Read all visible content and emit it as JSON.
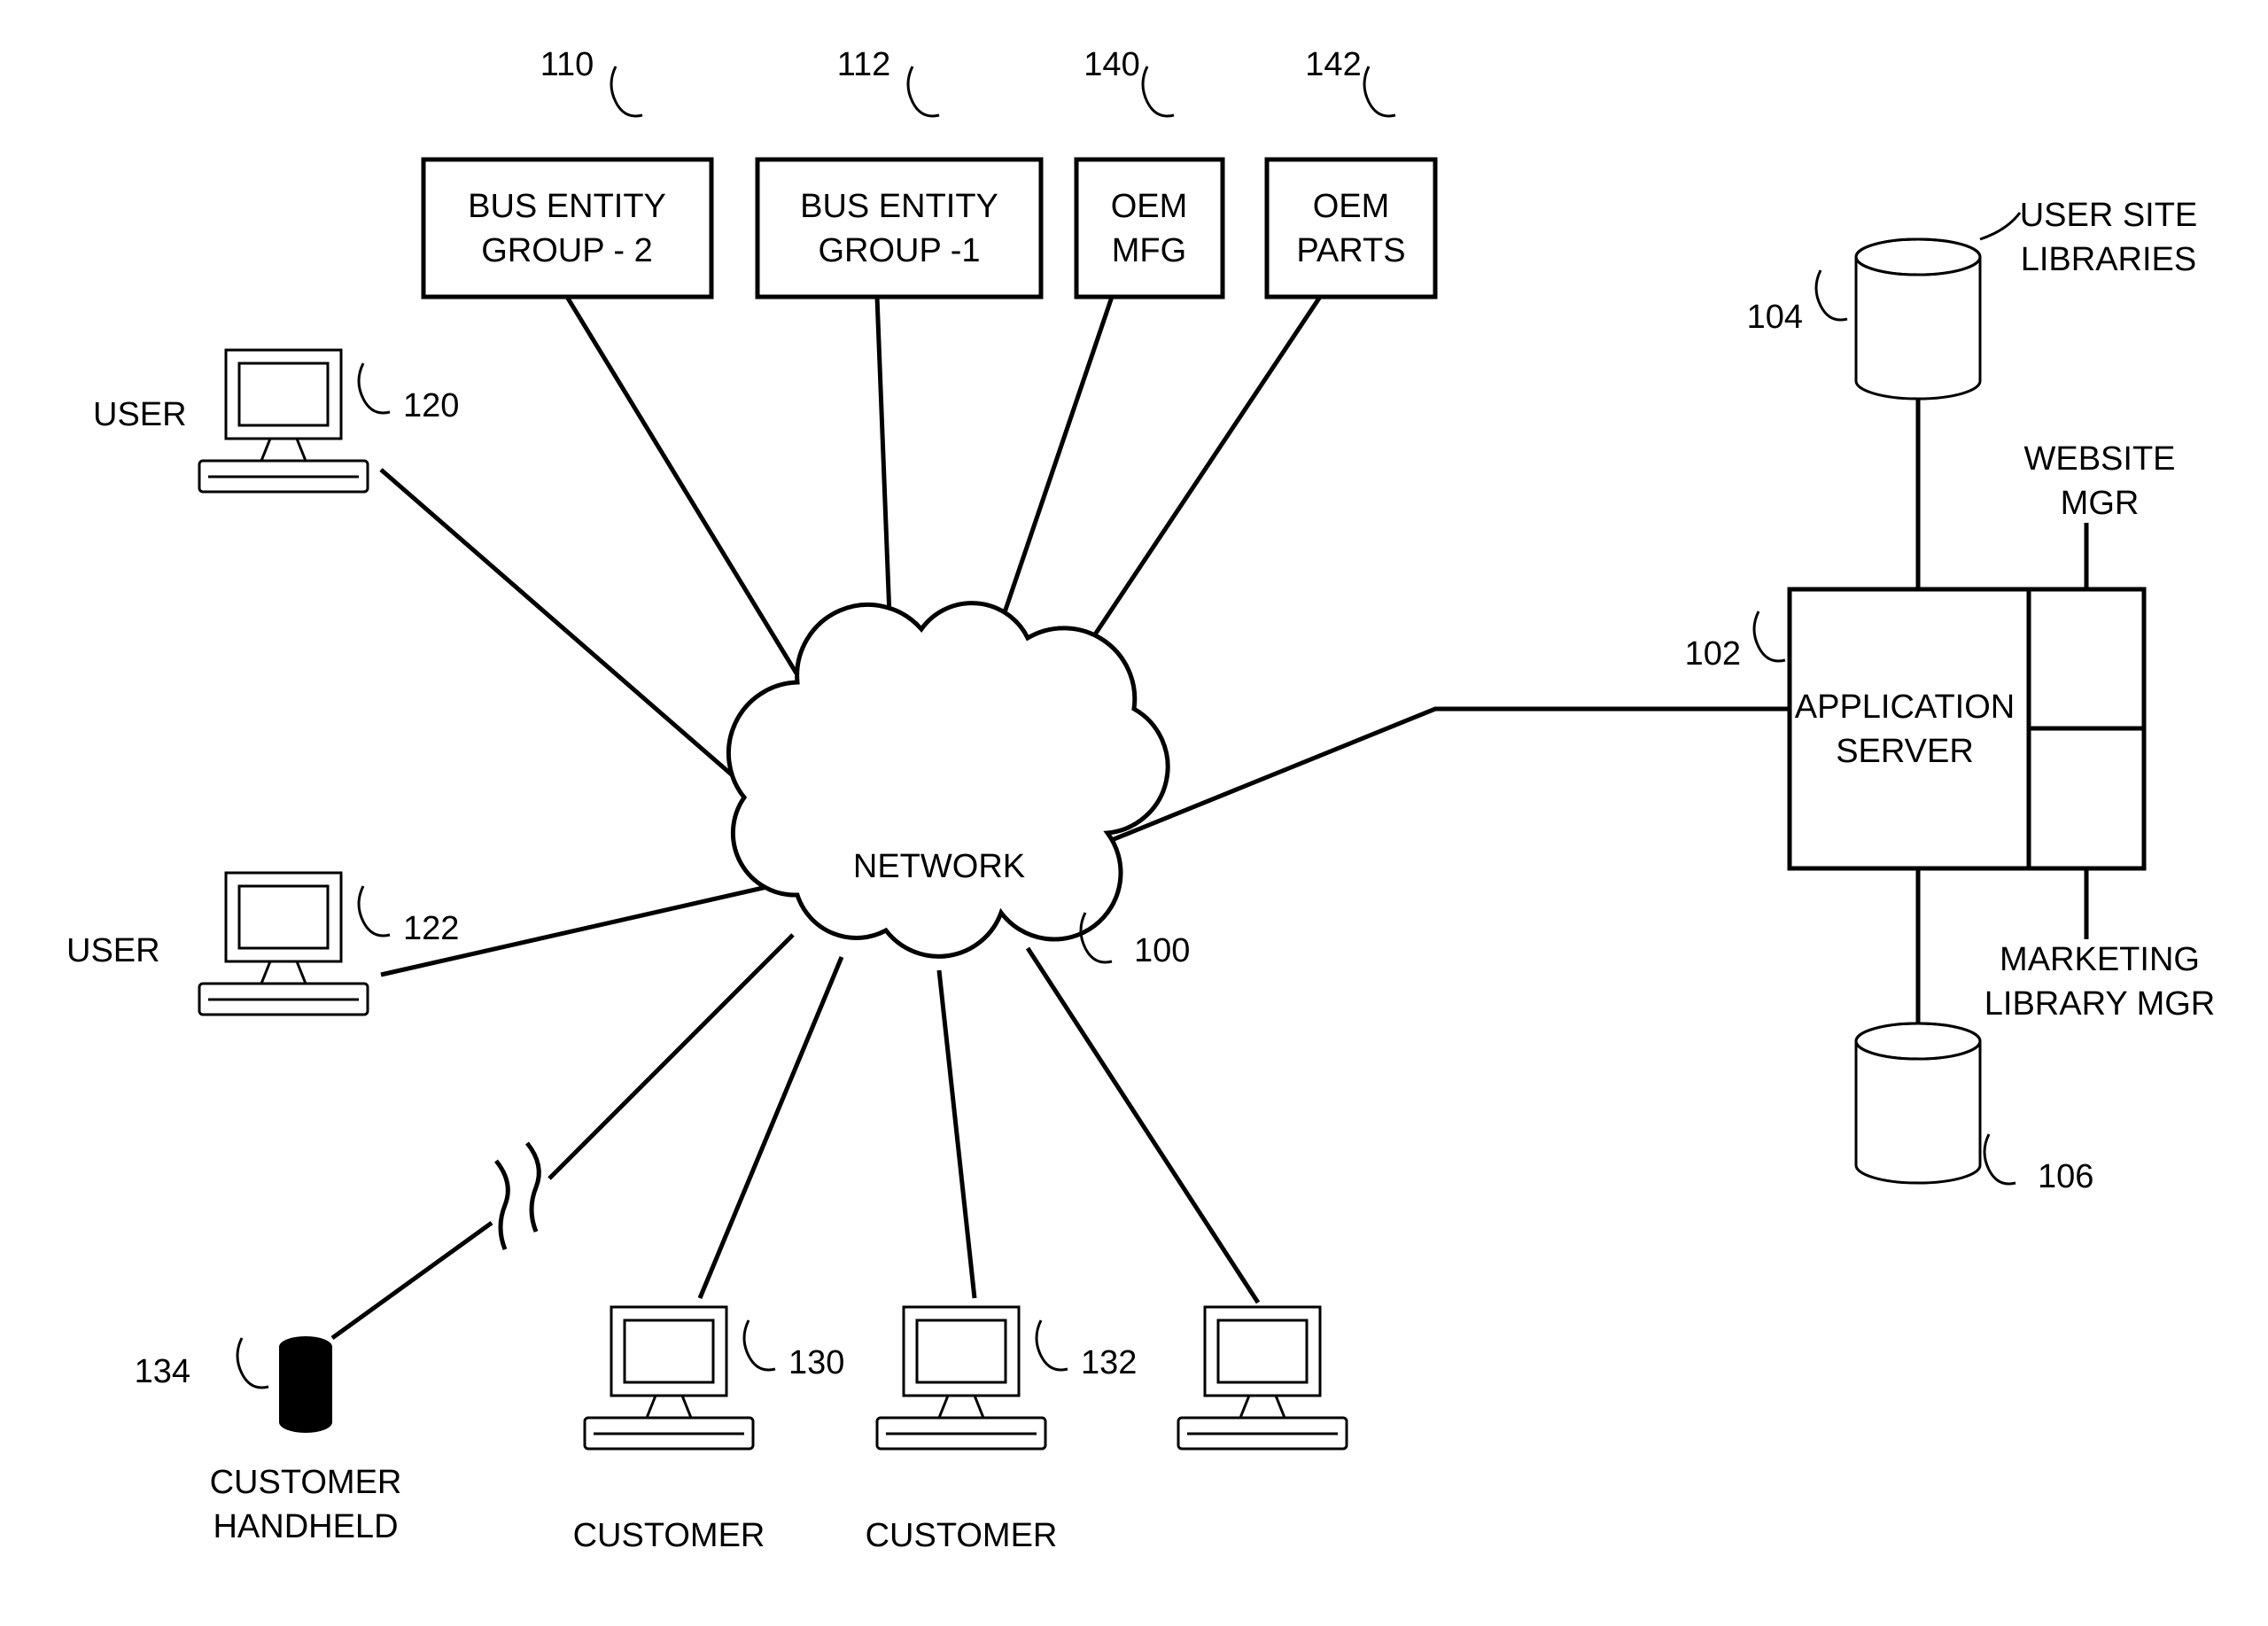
{
  "nodes": {
    "network": {
      "label": "NETWORK",
      "ref": "100"
    },
    "busEntity2": {
      "line1": "BUS ENTITY",
      "line2": "GROUP - 2",
      "ref": "110"
    },
    "busEntity1": {
      "line1": "BUS ENTITY",
      "line2": "GROUP -1",
      "ref": "112"
    },
    "oemMfg": {
      "line1": "OEM",
      "line2": "MFG",
      "ref": "140"
    },
    "oemParts": {
      "line1": "OEM",
      "line2": "PARTS",
      "ref": "142"
    },
    "user1": {
      "label": "USER",
      "ref": "120"
    },
    "user2": {
      "label": "USER",
      "ref": "122"
    },
    "handheld": {
      "line1": "CUSTOMER",
      "line2": "HANDHELD",
      "ref": "134"
    },
    "customer1": {
      "label": "CUSTOMER",
      "ref": "130"
    },
    "customer2": {
      "label": "CUSTOMER",
      "ref": "132"
    },
    "appServer": {
      "line1": "APPLICATION",
      "line2": "SERVER",
      "ref": "102",
      "sub1": "WEBSITE",
      "sub1b": "MGR",
      "sub2": "MARKETING",
      "sub2b": "LIBRARY MGR"
    },
    "userLibs": {
      "line1": "USER SITE",
      "line2": "LIBRARIES",
      "ref": "104"
    },
    "lowerDb": {
      "ref": "106"
    }
  }
}
